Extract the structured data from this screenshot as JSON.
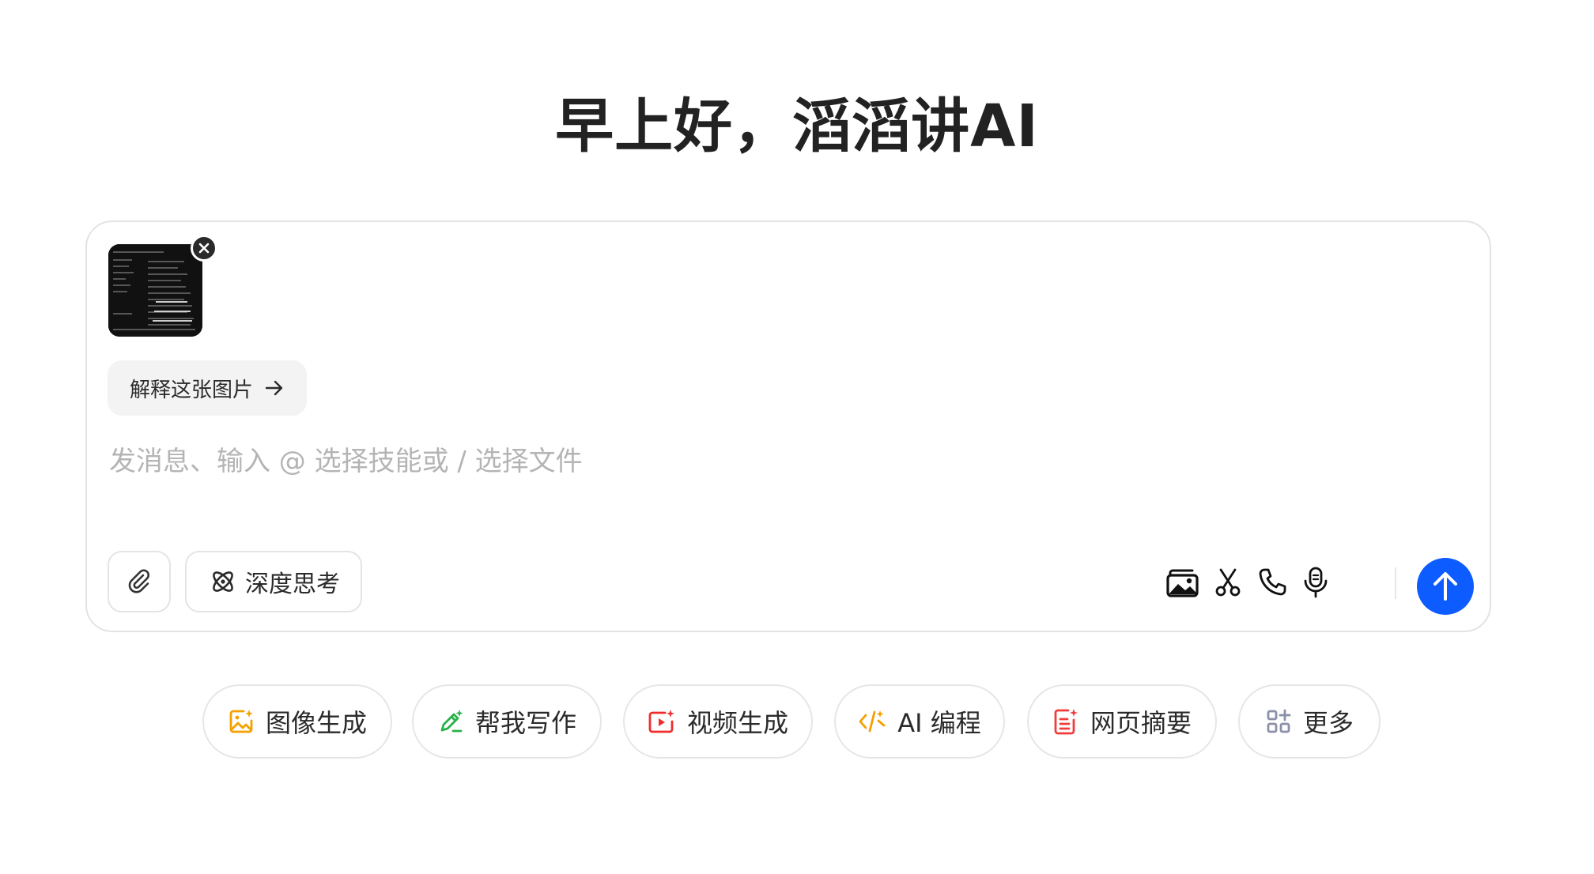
{
  "greeting": "早上好，滔滔讲AI",
  "composer": {
    "image_suggestion": "解释这张图片",
    "placeholder": "发消息、输入 @ 选择技能或 / 选择文件",
    "deep_think_label": "深度思考"
  },
  "toolbar_icons": [
    "image-edit-icon",
    "scissors-icon",
    "phone-icon",
    "microphone-icon"
  ],
  "skills": [
    {
      "label": "图像生成",
      "icon": "image-gen-icon",
      "color": "#f5a000"
    },
    {
      "label": "帮我写作",
      "icon": "pen-icon",
      "color": "#27b24a"
    },
    {
      "label": "视频生成",
      "icon": "video-icon",
      "color": "#f02d2d"
    },
    {
      "label": "AI 编程",
      "icon": "code-icon",
      "color": "#f5a000"
    },
    {
      "label": "网页摘要",
      "icon": "document-icon",
      "color": "#f03c3c"
    },
    {
      "label": "更多",
      "icon": "apps-icon",
      "color": "#8a90a8"
    }
  ],
  "colors": {
    "send_button": "#0d5cff",
    "placeholder": "#b4b4b4"
  }
}
